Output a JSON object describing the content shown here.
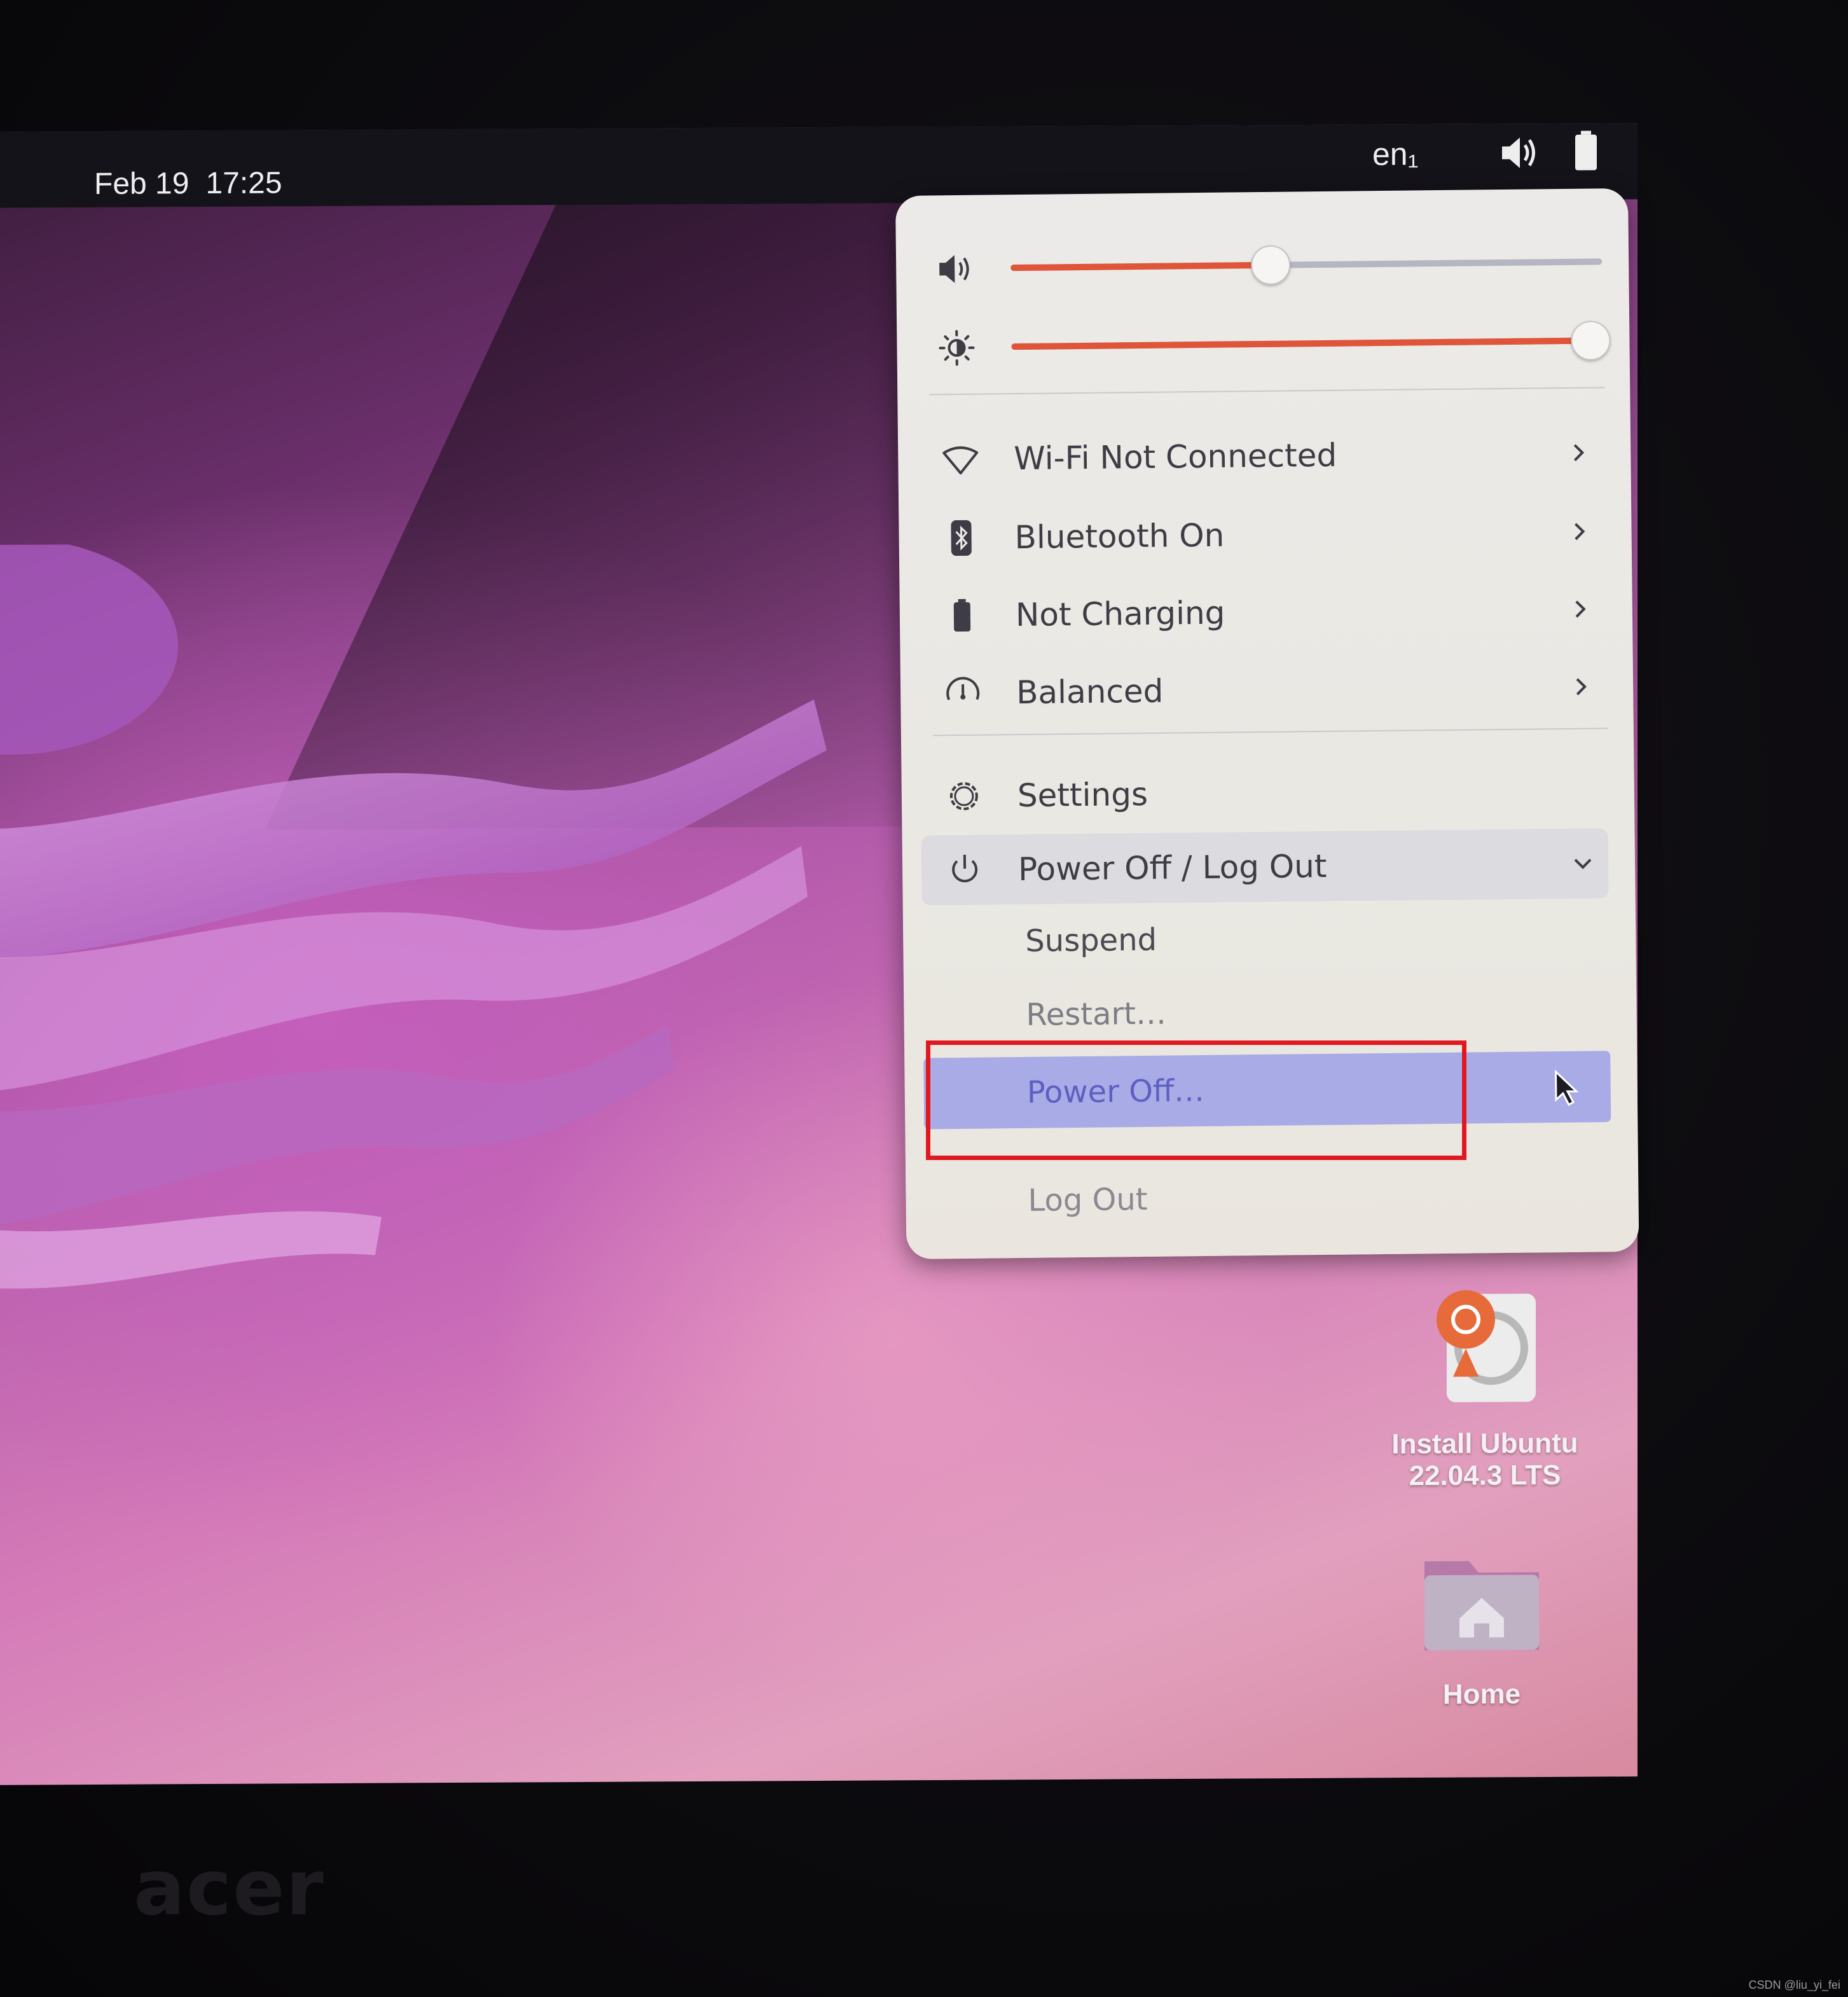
{
  "topbar": {
    "date": "Feb 19",
    "time": "17:25",
    "input_method": "en₁"
  },
  "quick_settings": {
    "volume_level": 0.44,
    "brightness_level": 0.98,
    "items": [
      {
        "label": "Wi-Fi Not Connected",
        "icon": "wifi-icon"
      },
      {
        "label": "Bluetooth On",
        "icon": "bluetooth-icon"
      },
      {
        "label": "Not Charging",
        "icon": "battery-icon"
      },
      {
        "label": "Balanced",
        "icon": "power-profile-icon"
      }
    ],
    "settings_label": "Settings",
    "power_menu": {
      "label": "Power Off / Log Out",
      "expanded": true,
      "options": [
        "Suspend",
        "Restart…",
        "Power Off…",
        "Log Out"
      ],
      "hovered": "Power Off…"
    }
  },
  "desktop_icons": [
    {
      "label_line1": "Install Ubuntu",
      "label_line2": "22.04.3 LTS"
    },
    {
      "label_line1": "Home"
    }
  ],
  "bezel_brand": "acer",
  "watermark": "CSDN @liu_yi_fei",
  "colors": {
    "accent": "#e0553a",
    "highlight_box": "#e01820",
    "hover_row": "#a9abe6"
  }
}
